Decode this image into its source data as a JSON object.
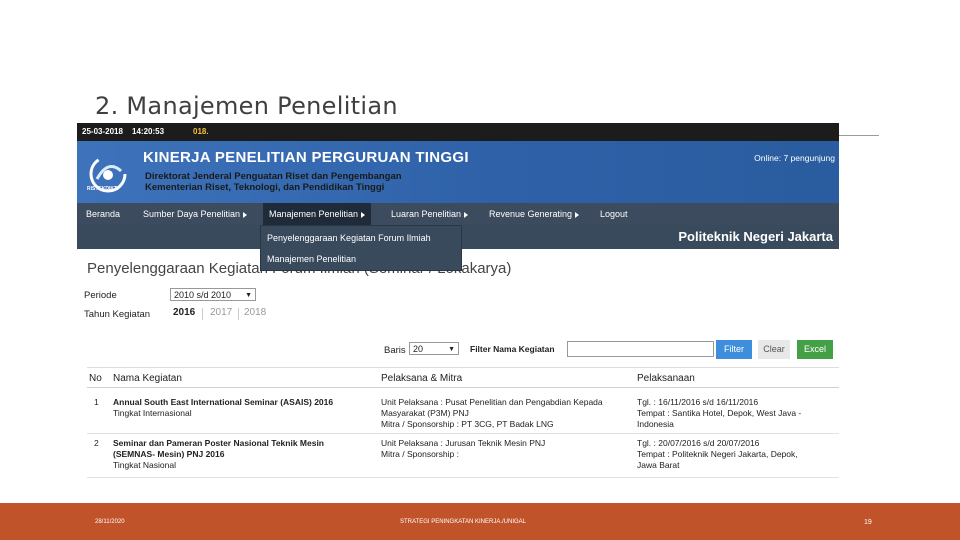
{
  "slide": {
    "title": "2. Manajemen Penelitian"
  },
  "topbar": {
    "date": "25-03-2018",
    "time": "14:20:53",
    "year_fragment": "018."
  },
  "banner": {
    "logo_text": "RISTEKDIKTI",
    "title": "KINERJA PENELITIAN PERGURUAN TINGGI",
    "subtitle_1": "Direktorat Jenderal Penguatan Riset dan Pengembangan",
    "subtitle_2": "Kementerian Riset, Teknologi, dan Pendidikan Tinggi",
    "online": "Online: 7 pengunjung"
  },
  "menu": {
    "items": [
      {
        "label": "Beranda"
      },
      {
        "label": "Sumber Daya Penelitian"
      },
      {
        "label": "Manajemen Penelitian"
      },
      {
        "label": "Luaran Penelitian"
      },
      {
        "label": "Revenue Generating"
      },
      {
        "label": "Logout"
      }
    ]
  },
  "dropdown": {
    "items": [
      {
        "label": "Penyelenggaraan Kegiatan Forum Ilmiah"
      },
      {
        "label": "Manajemen Penelitian"
      }
    ]
  },
  "institution": "Politeknik Negeri Jakarta",
  "page": {
    "heading": "Penyelenggaraan  Kegiatan Forum Ilmiah (Seminar / Lokakarya)",
    "periode_label": "Periode",
    "periode_value": "2010 s/d 2010",
    "tahun_label": "Tahun Kegiatan",
    "years": [
      "2016",
      "2017",
      "2018"
    ],
    "baris_label": "Baris",
    "baris_value": "20",
    "filter_label": "Filter Nama Kegiatan",
    "filter_value": "",
    "btn_filter": "Filter",
    "btn_clear": "Clear",
    "btn_excel": "Excel"
  },
  "table": {
    "headers": [
      "No",
      "Nama Kegiatan",
      "Pelaksana & Mitra",
      "Pelaksanaan"
    ],
    "rows": [
      {
        "no": "1",
        "name": "Annual South East International Seminar (ASAIS) 2016",
        "level": "Tingkat Internasional",
        "unit": "Unit Pelaksana : Pusat Penelitian dan Pengabdian Kepada",
        "unit2": "Masyarakat (P3M) PNJ",
        "mitra": "Mitra / Sponsorship : PT 3CG, PT Badak LNG",
        "tgl": "Tgl. : 16/11/2016 s/d 16/11/2016",
        "tempat": "Tempat : Santika Hotel, Depok, West Java -",
        "tempat2": "Indonesia"
      },
      {
        "no": "2",
        "name": "Seminar dan Pameran Poster Nasional Teknik Mesin",
        "name2": "(SEMNAS- Mesin) PNJ 2016",
        "level": "Tingkat Nasional",
        "unit": "Unit Pelaksana : Jurusan Teknik Mesin PNJ",
        "mitra": "Mitra / Sponsorship :",
        "tgl": "Tgl. : 20/07/2016 s/d 20/07/2016",
        "tempat": "Tempat : Politeknik Negeri Jakarta, Depok,",
        "tempat2": "Jawa Barat"
      }
    ]
  },
  "footer": {
    "date": "28/11/2020",
    "text": "STRATEGI PENINGKATAN KINERJA./UNIGAL",
    "page": "19"
  }
}
